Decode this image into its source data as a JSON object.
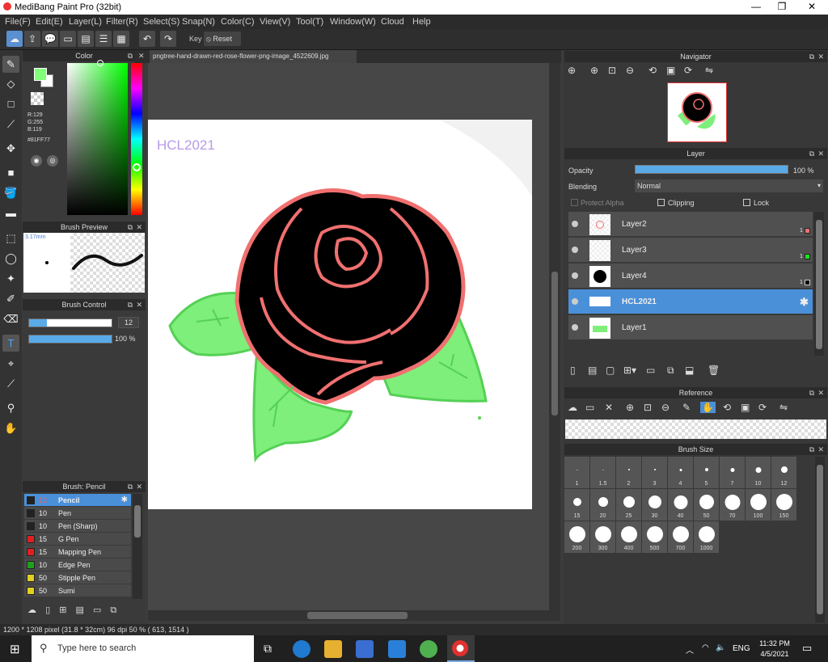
{
  "app": {
    "title": "MediBang Paint Pro (32bit)"
  },
  "menu": [
    "File(F)",
    "Edit(E)",
    "Layer(L)",
    "Filter(R)",
    "Select(S)",
    "Snap(N)",
    "Color(C)",
    "View(V)",
    "Tool(T)",
    "Window(W)",
    "Cloud",
    "Help"
  ],
  "toolbar": {
    "key_label": "Key",
    "reset_label": "Reset"
  },
  "color_panel": {
    "title": "Color",
    "r": "R:129",
    "g": "G:255",
    "b": "B:119",
    "hex": "#81FF77",
    "current_color": "#81FF77"
  },
  "brush_preview": {
    "title": "Brush Preview",
    "size": "3.17mm"
  },
  "brush_control": {
    "title": "Brush Control",
    "size_value": "12",
    "opacity_value": "100 %"
  },
  "brush_list": {
    "title": "Brush: Pencil",
    "items": [
      {
        "size": "12",
        "name": "Pencil",
        "color": "#222222"
      },
      {
        "size": "10",
        "name": "Pen",
        "color": "#222222"
      },
      {
        "size": "10",
        "name": "Pen (Sharp)",
        "color": "#222222"
      },
      {
        "size": "15",
        "name": "G Pen",
        "color": "#e02020"
      },
      {
        "size": "15",
        "name": "Mapping Pen",
        "color": "#e02020"
      },
      {
        "size": "10",
        "name": "Edge Pen",
        "color": "#20a020"
      },
      {
        "size": "50",
        "name": "Stipple Pen",
        "color": "#e0d020"
      },
      {
        "size": "50",
        "name": "Sumi",
        "color": "#e0d020"
      }
    ]
  },
  "document": {
    "tab": "pngtree-hand-drawn-red-rose-flower-png-image_4522609.jpg",
    "watermark_text": "HCL2021"
  },
  "navigator": {
    "title": "Navigator"
  },
  "layer_panel": {
    "title": "Layer",
    "opacity_label": "Opacity",
    "opacity_value": "100 %",
    "blending_label": "Blending",
    "blending_value": "Normal",
    "protect_alpha": "Protect Alpha",
    "clipping": "Clipping",
    "lock": "Lock",
    "layers": [
      {
        "name": "Layer2",
        "badge": "1"
      },
      {
        "name": "Layer3",
        "badge": "1"
      },
      {
        "name": "Layer4",
        "badge": "1"
      },
      {
        "name": "HCL2021",
        "badge": ""
      },
      {
        "name": "Layer1",
        "badge": ""
      }
    ]
  },
  "reference": {
    "title": "Reference"
  },
  "brush_size": {
    "title": "Brush Size",
    "sizes": [
      "1",
      "1.5",
      "2",
      "3",
      "4",
      "5",
      "7",
      "10",
      "12",
      "15",
      "20",
      "25",
      "30",
      "40",
      "50",
      "70",
      "100",
      "150",
      "200",
      "300",
      "400",
      "500",
      "700",
      "1000"
    ]
  },
  "status": {
    "text": "1200 * 1208 pixel   (31.8 * 32cm)   96 dpi   50 %   ( 613, 1514 )"
  },
  "taskbar": {
    "search_placeholder": "Type here to search",
    "lang": "ENG",
    "time": "11:32 PM",
    "date": "4/5/2021"
  }
}
